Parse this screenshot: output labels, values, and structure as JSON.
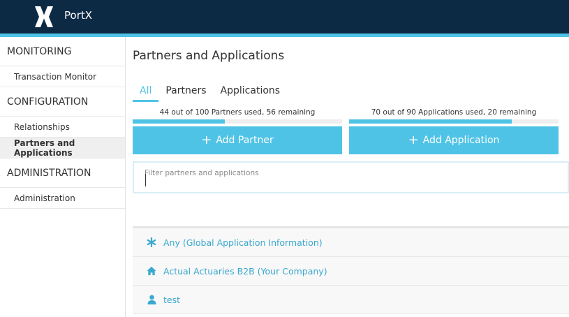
{
  "app": {
    "name": "PortX"
  },
  "colors": {
    "topbar": "#0d2a45",
    "accent": "#4fc3e6",
    "link": "#3aa8cf"
  },
  "sidebar": {
    "sections": [
      {
        "title": "MONITORING",
        "items": [
          {
            "label": "Transaction Monitor",
            "active": false
          }
        ]
      },
      {
        "title": "CONFIGURATION",
        "items": [
          {
            "label": "Relationships",
            "active": false
          },
          {
            "label": "Partners and Applications",
            "active": true
          }
        ]
      },
      {
        "title": "ADMINISTRATION",
        "items": [
          {
            "label": "Administration",
            "active": false
          }
        ]
      }
    ]
  },
  "main": {
    "title": "Partners and Applications",
    "tabs": [
      {
        "label": "All",
        "active": true
      },
      {
        "label": "Partners",
        "active": false
      },
      {
        "label": "Applications",
        "active": false
      }
    ],
    "partners_quota": {
      "text": "44 out of 100 Partners used, 56 remaining",
      "used": 44,
      "total": 100
    },
    "apps_quota": {
      "text": "70 out of 90 Applications used, 20 remaining",
      "used": 70,
      "total": 90
    },
    "add_partner_label": "Add Partner",
    "add_application_label": "Add Application",
    "filter": {
      "placeholder": "Filter partners and applications",
      "value": ""
    },
    "list": [
      {
        "label": "Any (Global Application Information)",
        "icon": "asterisk-icon"
      },
      {
        "label": "Actual Actuaries B2B (Your Company)",
        "icon": "home-icon"
      },
      {
        "label": "test",
        "icon": "user-icon"
      }
    ]
  }
}
